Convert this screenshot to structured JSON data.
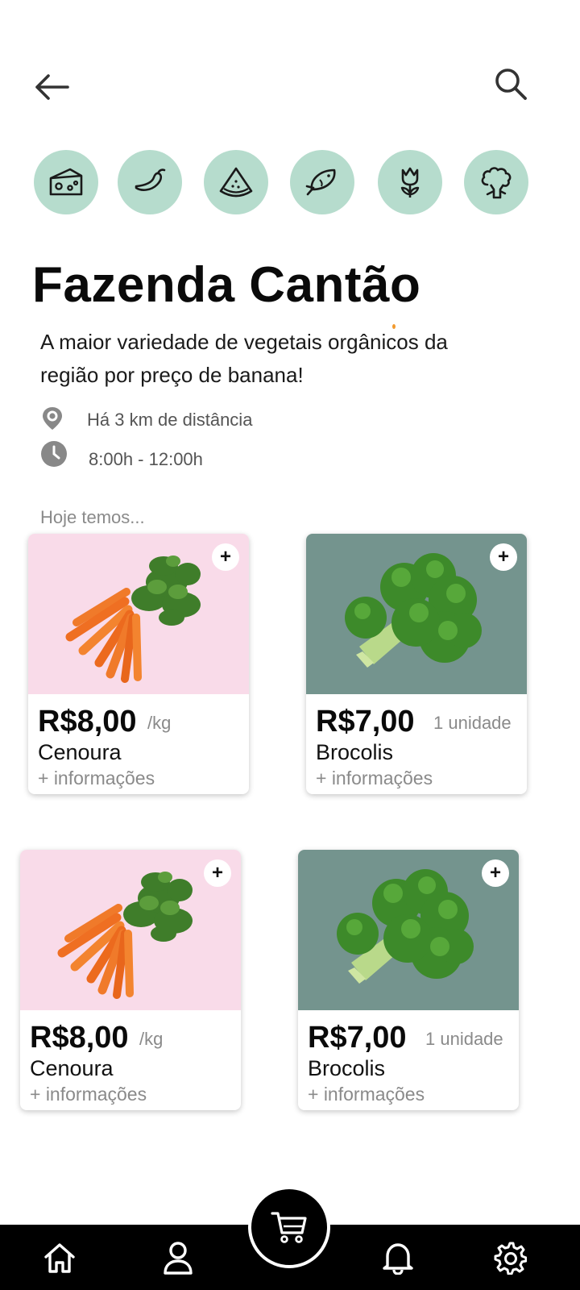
{
  "header": {
    "back_icon": "arrow-left-icon",
    "search_icon": "search-icon"
  },
  "categories": [
    {
      "icon": "cheese-icon"
    },
    {
      "icon": "pepper-icon"
    },
    {
      "icon": "watermelon-icon"
    },
    {
      "icon": "fish-icon"
    },
    {
      "icon": "tulip-icon"
    },
    {
      "icon": "broccoli-icon"
    }
  ],
  "store": {
    "name": "Fazenda Cantão",
    "description": "A maior variedade de vegetais orgânicos da região por preço de banana!",
    "distance": "Há 3 km de distância",
    "hours": "8:00h - 12:00h"
  },
  "section_label": "Hoje temos...",
  "products": [
    {
      "price": "R$8,00",
      "unit": "/kg",
      "name": "Cenoura",
      "more": "+ informações",
      "image": "carrot-bunch"
    },
    {
      "price": "R$7,00",
      "unit": "1 unidade",
      "name": "Brocolis",
      "more": "+ informações",
      "image": "broccoli"
    },
    {
      "price": "R$8,00",
      "unit": "/kg",
      "name": "Cenoura",
      "more": "+ informações",
      "image": "carrot-bunch"
    },
    {
      "price": "R$7,00",
      "unit": "1 unidade",
      "name": "Brocolis",
      "more": "+ informações",
      "image": "broccoli"
    }
  ],
  "add_label": "+",
  "nav": {
    "items": [
      "home-icon",
      "profile-icon",
      "cart-icon",
      "bell-icon",
      "settings-icon"
    ]
  },
  "colors": {
    "category_bg": "#b6dccd",
    "carrot_card_bg": "#f9dbe9",
    "broccoli_card_bg": "#74948e",
    "nav_bg": "#000000"
  }
}
